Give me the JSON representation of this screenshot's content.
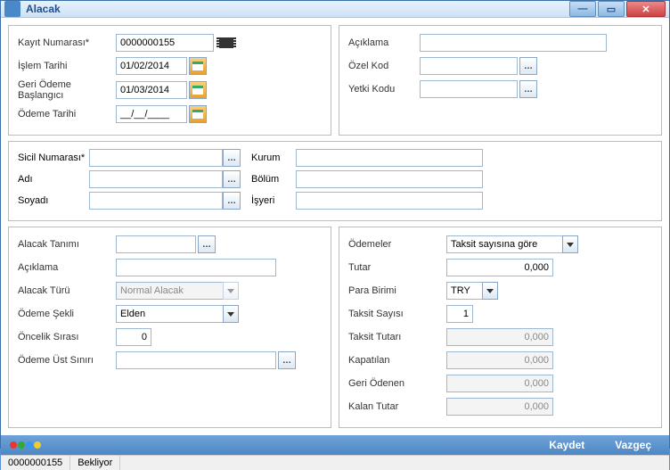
{
  "window": {
    "title": "Alacak"
  },
  "top_left": {
    "kayit_numarasi_label": "Kayıt Numarası*",
    "kayit_numarasi": "0000000155",
    "islem_tarihi_label": "İşlem Tarihi",
    "islem_tarihi": "01/02/2014",
    "geri_odeme_label": "Geri Ödeme Başlangıcı",
    "geri_odeme": "01/03/2014",
    "odeme_tarihi_label": "Ödeme Tarihi",
    "odeme_tarihi": "__/__/____"
  },
  "top_right": {
    "aciklama_label": "Açıklama",
    "aciklama": "",
    "ozel_kod_label": "Özel Kod",
    "ozel_kod": "",
    "yetki_kodu_label": "Yetki Kodu",
    "yetki_kodu": ""
  },
  "person": {
    "sicil_label": "Sicil Numarası*",
    "sicil": "",
    "adi_label": "Adı",
    "adi": "",
    "soyadi_label": "Soyadı",
    "soyadi": "",
    "kurum_label": "Kurum",
    "kurum": "",
    "bolum_label": "Bölüm",
    "bolum": "",
    "isyeri_label": "İşyeri",
    "isyeri": ""
  },
  "left": {
    "alacak_tanimi_label": "Alacak Tanımı",
    "alacak_tanimi": "",
    "aciklama_label": "Açıklama",
    "aciklama": "",
    "alacak_turu_label": "Alacak Türü",
    "alacak_turu": "Normal Alacak",
    "odeme_sekli_label": "Ödeme Şekli",
    "odeme_sekli": "Elden",
    "oncelik_label": "Öncelik Sırası",
    "oncelik": "0",
    "odeme_ust_label": "Ödeme Üst Sınırı",
    "odeme_ust": ""
  },
  "right": {
    "odemeler_label": "Ödemeler",
    "odemeler": "Taksit sayısına göre",
    "tutar_label": "Tutar",
    "tutar": "0,000",
    "para_birimi_label": "Para Birimi",
    "para_birimi": "TRY",
    "taksit_sayisi_label": "Taksit Sayısı",
    "taksit_sayisi": "1",
    "taksit_tutari_label": "Taksit Tutarı",
    "taksit_tutari": "0,000",
    "kapatilan_label": "Kapatılan",
    "kapatilan": "0,000",
    "geri_odenen_label": "Geri Ödenen",
    "geri_odenen": "0,000",
    "kalan_tutar_label": "Kalan Tutar",
    "kalan_tutar": "0,000"
  },
  "actions": {
    "kaydet": "Kaydet",
    "vazgec": "Vazgeç"
  },
  "status": {
    "id": "0000000155",
    "state": "Bekliyor"
  }
}
